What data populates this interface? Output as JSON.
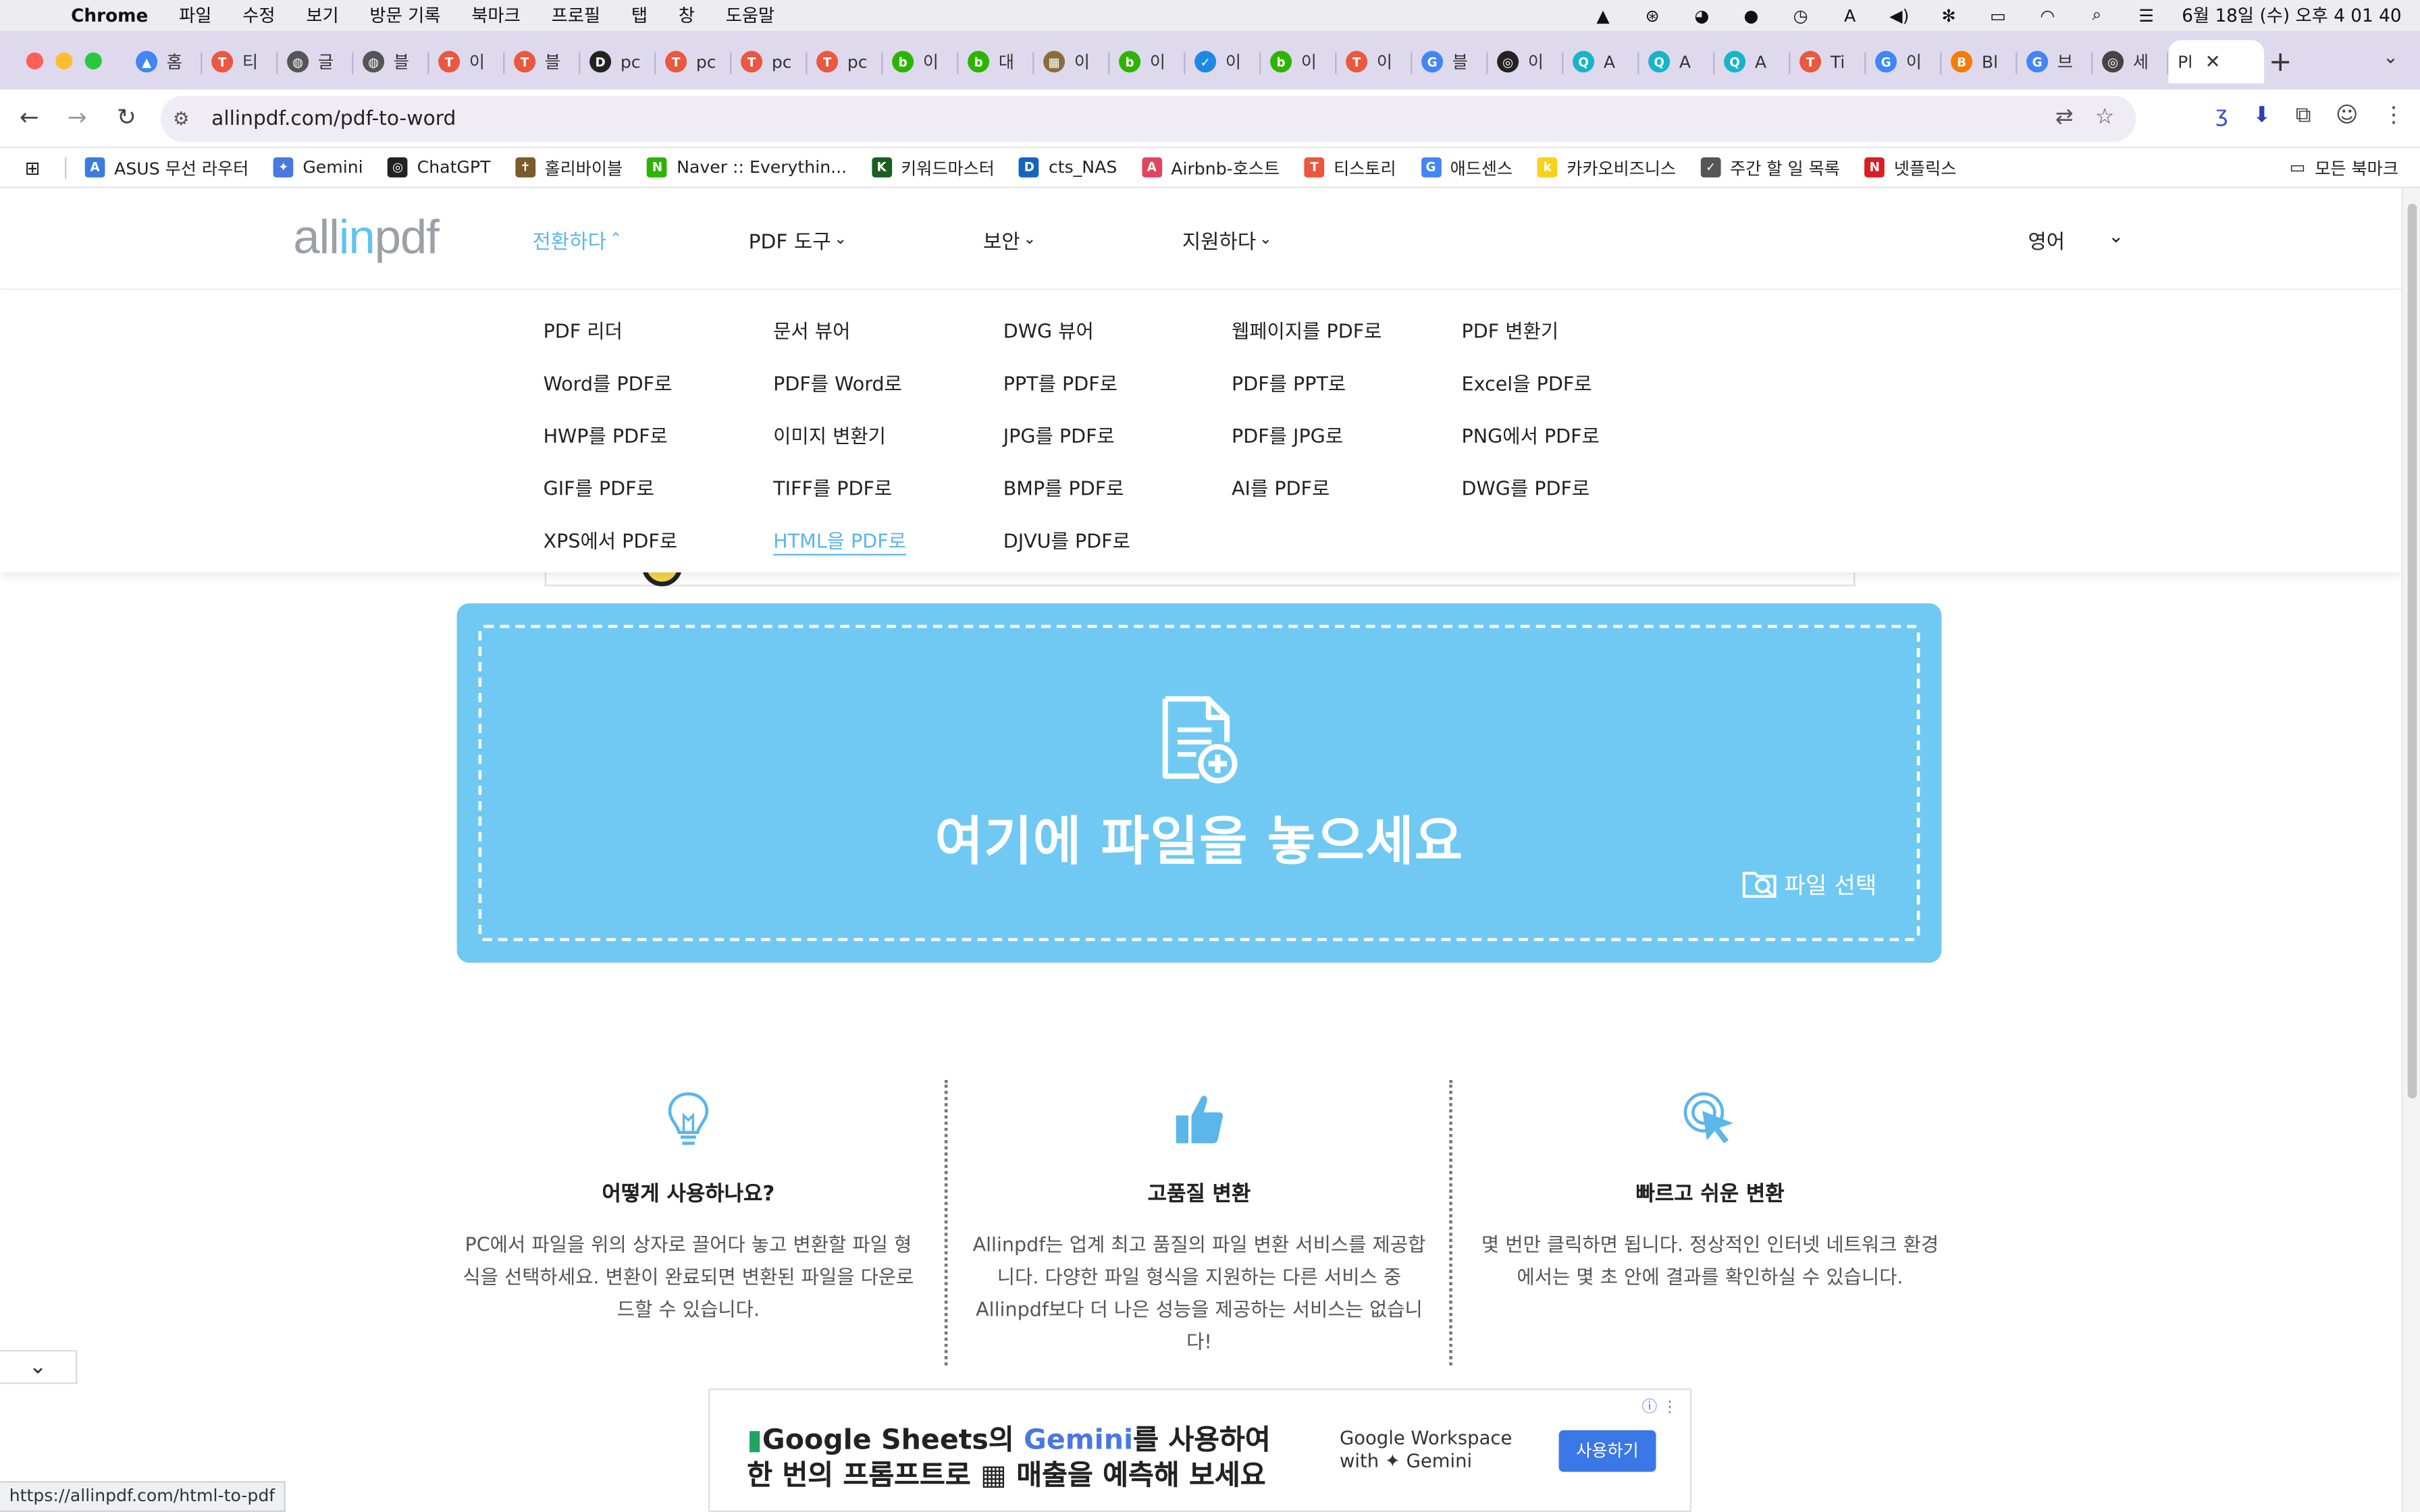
{
  "menubar": {
    "app": "Chrome",
    "items": [
      "파일",
      "수정",
      "보기",
      "방문 기록",
      "북마크",
      "프로필",
      "탭",
      "창",
      "도움말"
    ],
    "clock": "6월 18일 (수) 오후 4 01 40"
  },
  "tabs": [
    {
      "label": "홈",
      "color": "#4285f4",
      "glyph": "▲"
    },
    {
      "label": "티",
      "color": "#e9583f",
      "glyph": "T"
    },
    {
      "label": "글",
      "color": "#555555",
      "glyph": "◍"
    },
    {
      "label": "블",
      "color": "#555555",
      "glyph": "◍"
    },
    {
      "label": "이",
      "color": "#e9583f",
      "glyph": "T"
    },
    {
      "label": "블",
      "color": "#e9583f",
      "glyph": "T"
    },
    {
      "label": "pc",
      "color": "#222222",
      "glyph": "D"
    },
    {
      "label": "pc",
      "color": "#e9583f",
      "glyph": "T"
    },
    {
      "label": "pc",
      "color": "#e9583f",
      "glyph": "T"
    },
    {
      "label": "pc",
      "color": "#e9583f",
      "glyph": "T"
    },
    {
      "label": "이",
      "color": "#2db400",
      "glyph": "b"
    },
    {
      "label": "대",
      "color": "#2db400",
      "glyph": "b"
    },
    {
      "label": "이",
      "color": "#8a6d3b",
      "glyph": "▦"
    },
    {
      "label": "이",
      "color": "#2db400",
      "glyph": "b"
    },
    {
      "label": "이",
      "color": "#1e88e5",
      "glyph": "✓"
    },
    {
      "label": "이",
      "color": "#2db400",
      "glyph": "b"
    },
    {
      "label": "이",
      "color": "#e9583f",
      "glyph": "T"
    },
    {
      "label": "블",
      "color": "#4285f4",
      "glyph": "G"
    },
    {
      "label": "이",
      "color": "#222222",
      "glyph": "◎"
    },
    {
      "label": "A",
      "color": "#18b4c8",
      "glyph": "Q"
    },
    {
      "label": "A",
      "color": "#18b4c8",
      "glyph": "Q"
    },
    {
      "label": "A",
      "color": "#18b4c8",
      "glyph": "Q"
    },
    {
      "label": "Ti",
      "color": "#e9583f",
      "glyph": "T"
    },
    {
      "label": "이",
      "color": "#4285f4",
      "glyph": "G"
    },
    {
      "label": "Bl",
      "color": "#f57c00",
      "glyph": "B"
    },
    {
      "label": "브",
      "color": "#4285f4",
      "glyph": "G"
    },
    {
      "label": "세",
      "color": "#444444",
      "glyph": "◎"
    }
  ],
  "active_tab": {
    "label": "Pl",
    "close": "✕"
  },
  "toolbar": {
    "url": "allinpdf.com/pdf-to-word"
  },
  "bookmarks": [
    {
      "label": "ASUS 무선 라우터",
      "color": "#3b7ddd",
      "glyph": "A"
    },
    {
      "label": "Gemini",
      "color": "#4a77e0",
      "glyph": "✦"
    },
    {
      "label": "ChatGPT",
      "color": "#222222",
      "glyph": "◎"
    },
    {
      "label": "홀리바이블",
      "color": "#7a5b2e",
      "glyph": "✝"
    },
    {
      "label": "Naver :: Everythin...",
      "color": "#2db400",
      "glyph": "N"
    },
    {
      "label": "키워드마스터",
      "color": "#1b5e20",
      "glyph": "K"
    },
    {
      "label": "cts_NAS",
      "color": "#1565c0",
      "glyph": "D"
    },
    {
      "label": "Airbnb-호스트",
      "color": "#e0455d",
      "glyph": "A"
    },
    {
      "label": "티스토리",
      "color": "#e9583f",
      "glyph": "T"
    },
    {
      "label": "애드센스",
      "color": "#4285f4",
      "glyph": "G"
    },
    {
      "label": "카카오비즈니스",
      "color": "#f7d21b",
      "glyph": "k"
    },
    {
      "label": "주간 할 일 목록",
      "color": "#555555",
      "glyph": "✓"
    },
    {
      "label": "넷플릭스",
      "color": "#d81f26",
      "glyph": "N"
    }
  ],
  "all_bookmarks": "모든 북마크",
  "site": {
    "logo_a": "all",
    "logo_b": "in",
    "logo_c": "pdf",
    "nav": [
      "전환하다",
      "PDF 도구",
      "보안",
      "지원하다"
    ],
    "language": "영어"
  },
  "mega_menu": [
    [
      "PDF 리더",
      "Word를 PDF로",
      "HWP를 PDF로",
      "GIF를 PDF로",
      "XPS에서 PDF로"
    ],
    [
      "문서 뷰어",
      "PDF를 Word로",
      "이미지 변환기",
      "TIFF를 PDF로",
      "HTML을 PDF로"
    ],
    [
      "DWG 뷰어",
      "PPT를 PDF로",
      "JPG를 PDF로",
      "BMP를 PDF로",
      "DJVU를 PDF로"
    ],
    [
      "웹페이지를 PDF로",
      "PDF를 PPT로",
      "PDF를 JPG로",
      "AI를 PDF로"
    ],
    [
      "PDF 변환기",
      "Excel을 PDF로",
      "PNG에서 PDF로",
      "DWG를 PDF로"
    ]
  ],
  "dropzone": {
    "title": "여기에 파일을 놓으세요",
    "pick": "파일 선택"
  },
  "features": [
    {
      "title": "어떻게 사용하나요?",
      "text": "PC에서 파일을 위의 상자로 끌어다 놓고 변환할 파일 형식을 선택하세요. 변환이 완료되면 변환된 파일을 다운로드할 수 있습니다."
    },
    {
      "title": "고품질 변환",
      "text": "Allinpdf는 업계 최고 품질의 파일 변환 서비스를 제공합니다. 다양한 파일 형식을 지원하는 다른 서비스 중 Allinpdf보다 더 나은 성능을 제공하는 서비스는 없습니다!"
    },
    {
      "title": "빠르고 쉬운 변환",
      "text": "몇 번만 클릭하면 됩니다. 정상적인 인터넷 네트워크 환경에서는 몇 초 안에 결과를 확인하실 수 있습니다."
    }
  ],
  "ad": {
    "l1a": "Google Sheets의 ",
    "l1b": "Gemini",
    "l1c": "를 사용하여",
    "l2": "한 번의 프롬프트로 ▦ 매출을 예측해 보세요",
    "brand1": "Google Workspace",
    "brand2": "with ✦ Gemini",
    "cta": "사용하기"
  },
  "status_url": "https://allinpdf.com/html-to-pdf",
  "colors": {
    "accent": "#5bb6ea",
    "dropzone": "#70c9f2"
  }
}
